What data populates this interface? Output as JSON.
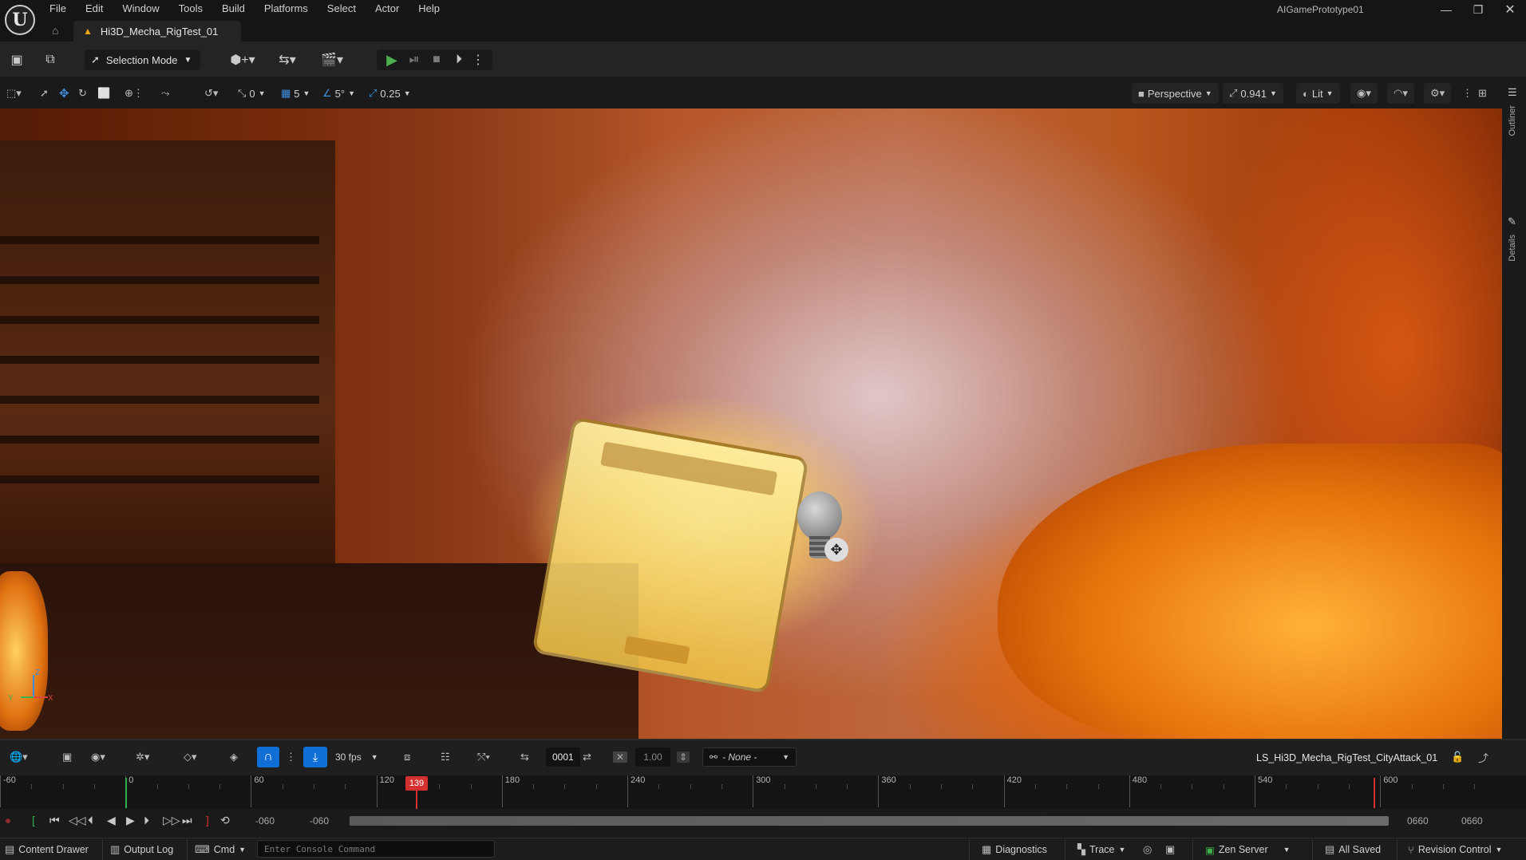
{
  "menu": [
    "File",
    "Edit",
    "Window",
    "Tools",
    "Build",
    "Platforms",
    "Select",
    "Actor",
    "Help"
  ],
  "project_name": "AIGamePrototype01",
  "document_tab": {
    "label": "Hi3D_Mecha_RigTest_01"
  },
  "toolbar": {
    "selection_mode": "Selection Mode"
  },
  "viewport_toolbar": {
    "rotate_snap": "0",
    "grid_snap": "5",
    "angle_snap": "5°",
    "scale_snap": "0.25",
    "view_mode": "Perspective",
    "fov": "0.941",
    "lit_mode": "Lit"
  },
  "right_panel": {
    "outliner": "Outliner",
    "details": "Details"
  },
  "sequencer": {
    "fps": "30 fps",
    "frame": "0001",
    "play_rate": "1.00",
    "camera_lock": "- None -",
    "sequence_name": "LS_Hi3D_Mecha_RigTest_CityAttack_01",
    "current_frame": "139",
    "ruler_ticks": [
      "-60",
      "0",
      "60",
      "120",
      "180",
      "240",
      "300",
      "360",
      "420",
      "480",
      "540",
      "600"
    ],
    "range_start": "-060",
    "range_start2": "-060",
    "range_end": "0660",
    "range_end2": "0660"
  },
  "statusbar": {
    "content_drawer": "Content Drawer",
    "output_log": "Output Log",
    "cmd": "Cmd",
    "console_placeholder": "Enter Console Command",
    "diagnostics": "Diagnostics",
    "trace": "Trace",
    "zen_server": "Zen Server",
    "all_saved": "All Saved",
    "revision_control": "Revision Control"
  },
  "colors": {
    "accent_blue": "#0f6fd6",
    "playhead_red": "#d43030",
    "play_green": "#4caf50"
  }
}
